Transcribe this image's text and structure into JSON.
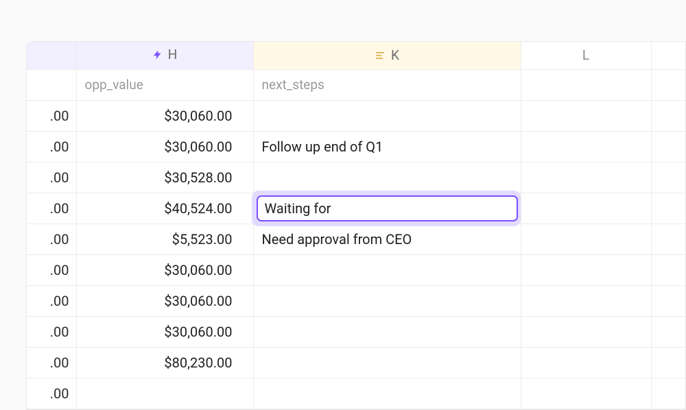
{
  "colors": {
    "accent": "#7B4EFF",
    "colH_bg": "#f2efff",
    "colK_bg": "#fff9e6"
  },
  "columns": {
    "h": {
      "letter": "H",
      "icon": "lightning-icon"
    },
    "k": {
      "letter": "K",
      "icon": "align-left-icon"
    },
    "l": {
      "letter": "L"
    }
  },
  "field_row": {
    "h": "opp_value",
    "k": "next_steps"
  },
  "stub_suffix": ".00",
  "rows": [
    {
      "value": "$30,060.00",
      "next": ""
    },
    {
      "value": "$30,060.00",
      "next": "Follow up end of Q1"
    },
    {
      "value": "$30,528.00",
      "next": ""
    },
    {
      "value": "$40,524.00",
      "next_editing": "Waiting for"
    },
    {
      "value": "$5,523.00",
      "next": "Need approval from CEO"
    },
    {
      "value": "$30,060.00",
      "next": ""
    },
    {
      "value": "$30,060.00",
      "next": ""
    },
    {
      "value": "$30,060.00",
      "next": ""
    },
    {
      "value": "$80,230.00",
      "next": ""
    },
    {
      "value": "",
      "next": ""
    }
  ]
}
